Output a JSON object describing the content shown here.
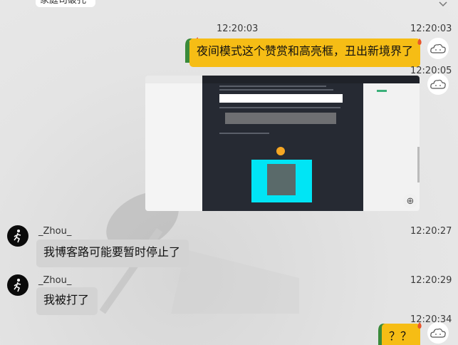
{
  "top_partial_text": "家庭司破孔",
  "messages": [
    {
      "time": "12:20:03",
      "from": "me",
      "text": "夜间模式这个赞赏和高亮框，丑出新境界了"
    },
    {
      "time": "12:20:05",
      "from": "me",
      "type": "image"
    },
    {
      "time": "12:20:27",
      "from": "other",
      "sender": "_Zhou_",
      "text": "我博客路可能要暂时停止了"
    },
    {
      "time": "12:20:29",
      "from": "other",
      "sender": "_Zhou_",
      "text": "我被打了"
    },
    {
      "time": "12:20:34",
      "from": "me",
      "text": "？？"
    }
  ],
  "center_time": "12:20:03",
  "colors": {
    "my_bubble": "#f6bd15",
    "other_bubble": "#d3d3d3",
    "background": "#e6e6e6"
  },
  "icons": {
    "zoom": "zoom-in-icon",
    "my_avatar": "cloud-avatar-icon",
    "other_avatar": "runner-avatar-icon",
    "scroll": "chevron-up-icon"
  }
}
